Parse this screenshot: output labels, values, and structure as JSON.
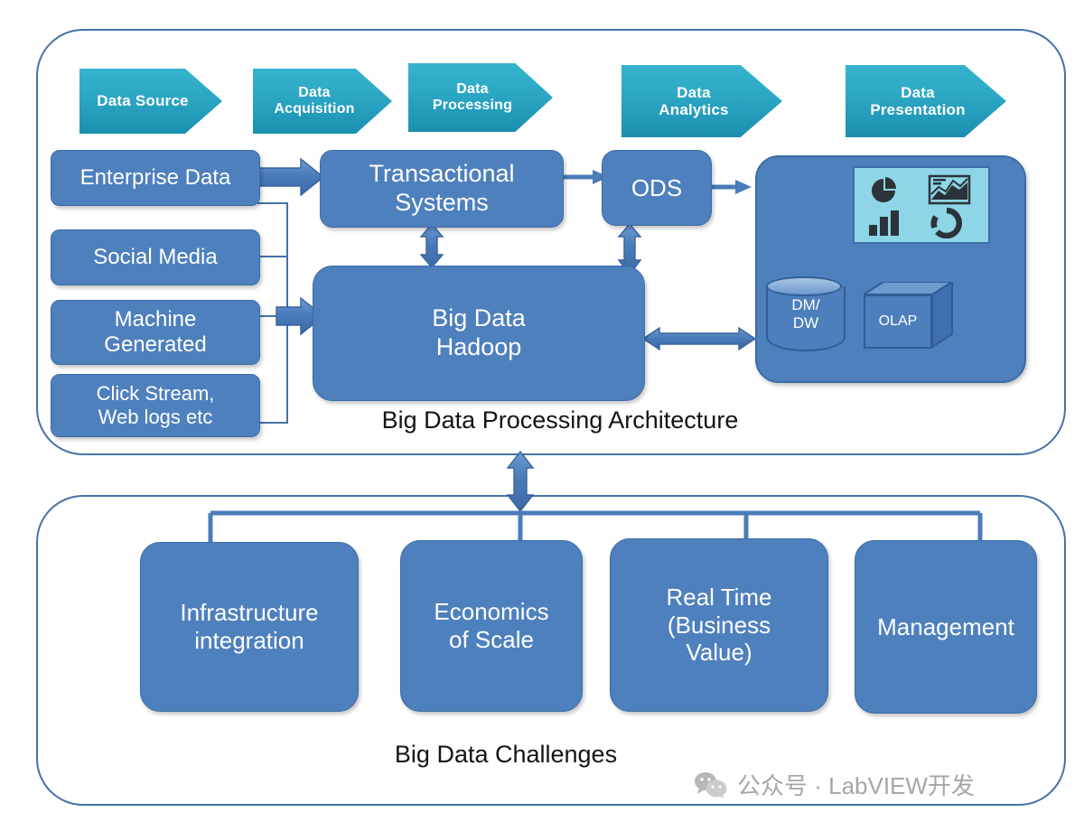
{
  "diagram": {
    "architecture": {
      "caption": "Big Data Processing Architecture",
      "stages": [
        {
          "label": "Data Source",
          "id": "data-source"
        },
        {
          "label": "Data\nAcquisition",
          "line1": "Data",
          "line2": "Acquisition",
          "id": "data-acquisition"
        },
        {
          "label": "Data\nProcessing",
          "line1": "Data",
          "line2": "Processing",
          "id": "data-processing"
        },
        {
          "label": "Data\nAnalytics",
          "line1": "Data",
          "line2": "Analytics",
          "id": "data-analytics"
        },
        {
          "label": "Data\nPresentation",
          "line1": "Data",
          "line2": "Presentation",
          "id": "data-presentation"
        }
      ],
      "sources": [
        {
          "label": "Enterprise Data"
        },
        {
          "label": "Social Media"
        },
        {
          "line1": "Machine",
          "line2": "Generated"
        },
        {
          "line1": "Click Stream,",
          "line2": "Web logs etc"
        }
      ],
      "nodes": {
        "transactional": {
          "line1": "Transactional",
          "line2": "Systems"
        },
        "hadoop": {
          "line1": "Big Data",
          "line2": "Hadoop"
        },
        "ods": {
          "label": "ODS"
        },
        "dmdw": {
          "line1": "DM/",
          "line2": "DW"
        },
        "olap": {
          "label": "OLAP"
        }
      },
      "dashboard_icons": [
        "pie-chart-icon",
        "area-chart-icon",
        "bar-chart-icon",
        "donut-chart-icon"
      ]
    },
    "challenges": {
      "caption": "Big Data Challenges",
      "items": [
        {
          "line1": "Infrastructure",
          "line2": "integration",
          "line3": "",
          "line4": ""
        },
        {
          "line1": "Economics",
          "line2": "of Scale",
          "line3": "",
          "line4": ""
        },
        {
          "line1": "Real Time",
          "line2": "(Business",
          "line3": "Value)",
          "line4": ""
        },
        {
          "line1": "Management",
          "line2": "",
          "line3": "",
          "line4": ""
        }
      ]
    }
  },
  "watermark": {
    "icon": "wechat-icon",
    "text": "公众号 · LabVIEW开发"
  },
  "colors": {
    "box_blue": "#4e80bd",
    "box_border": "#3c6ca5",
    "chevron_teal_light": "#37b3cd",
    "chevron_teal_dark": "#1b8fb0",
    "panel_border": "#4472a8",
    "dashboard_tile": "#8ed5e7",
    "icon_dark": "#2b3339",
    "watermark_gray": "#a6a6a6"
  }
}
